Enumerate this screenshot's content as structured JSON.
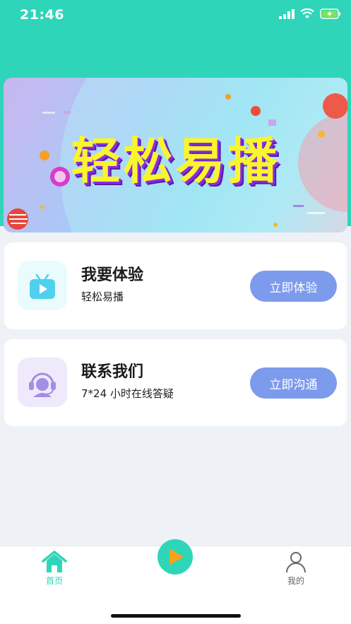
{
  "status_bar": {
    "time": "21:46"
  },
  "banner": {
    "title": "轻松易播"
  },
  "cards": [
    {
      "title": "我要体验",
      "subtitle": "轻松易播",
      "button": "立即体验",
      "icon": "tv-play-icon"
    },
    {
      "title": "联系我们",
      "subtitle": "7*24 小时在线答疑",
      "button": "立即沟通",
      "icon": "headset-support-icon"
    }
  ],
  "tabbar": {
    "home": "首页",
    "center": "play-icon",
    "mine": "我的"
  },
  "colors": {
    "accent": "#2fd5b9",
    "button": "#7d9bec",
    "banner_text": "#f8f52d"
  }
}
